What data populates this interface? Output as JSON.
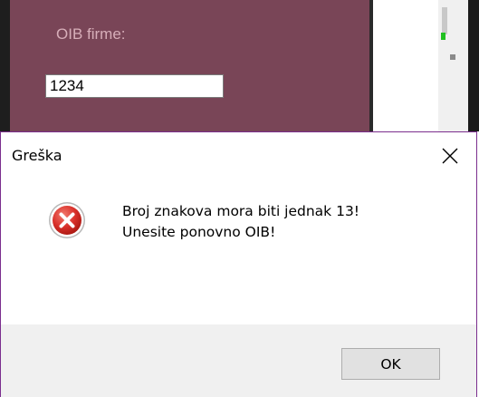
{
  "background_form": {
    "oib_label": "OIB firme:",
    "oib_value": "1234"
  },
  "dialog": {
    "title": "Greška",
    "message_line1": "Broj znakova mora biti jednak 13!",
    "message_line2": "Unesite ponovno OIB!",
    "ok_label": "OK",
    "icon": "error-icon",
    "close_icon": "close-icon"
  },
  "colors": {
    "panel": "#794557",
    "label": "#d7aeb9",
    "dialog_border": "#7b2e8e",
    "error_red": "#d9302a",
    "button_bar": "#f0f0f0"
  }
}
